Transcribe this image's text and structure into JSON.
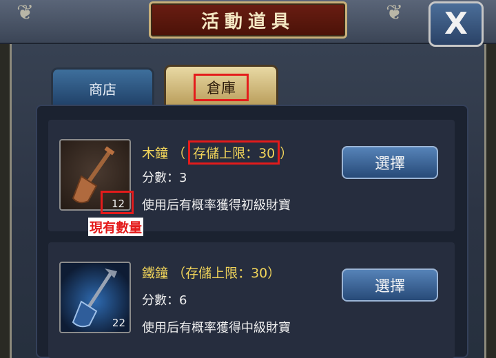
{
  "window": {
    "title": "活動道具",
    "close_label": "X"
  },
  "tabs": [
    {
      "label": "商店",
      "active": false
    },
    {
      "label": "倉庫",
      "active": true
    }
  ],
  "items": [
    {
      "name": "木鐘",
      "limit_text": "存儲上限：30",
      "score_text": "分數：3",
      "description": "使用后有概率獲得初級財寶",
      "quantity": "12",
      "select_label": "選擇",
      "icon": "wooden-shovel-icon"
    },
    {
      "name": "鐵鐘",
      "limit_text": "存儲上限：30",
      "score_text": "分數：6",
      "description": "使用后有概率獲得中級財寶",
      "quantity": "22",
      "select_label": "選擇",
      "icon": "iron-shovel-icon"
    }
  ],
  "annotations": {
    "current_quantity_label": "現有數量"
  },
  "colors": {
    "highlight": "#e41b1b",
    "item_name": "#f2d55a",
    "title_plate": "#6a1d12"
  }
}
